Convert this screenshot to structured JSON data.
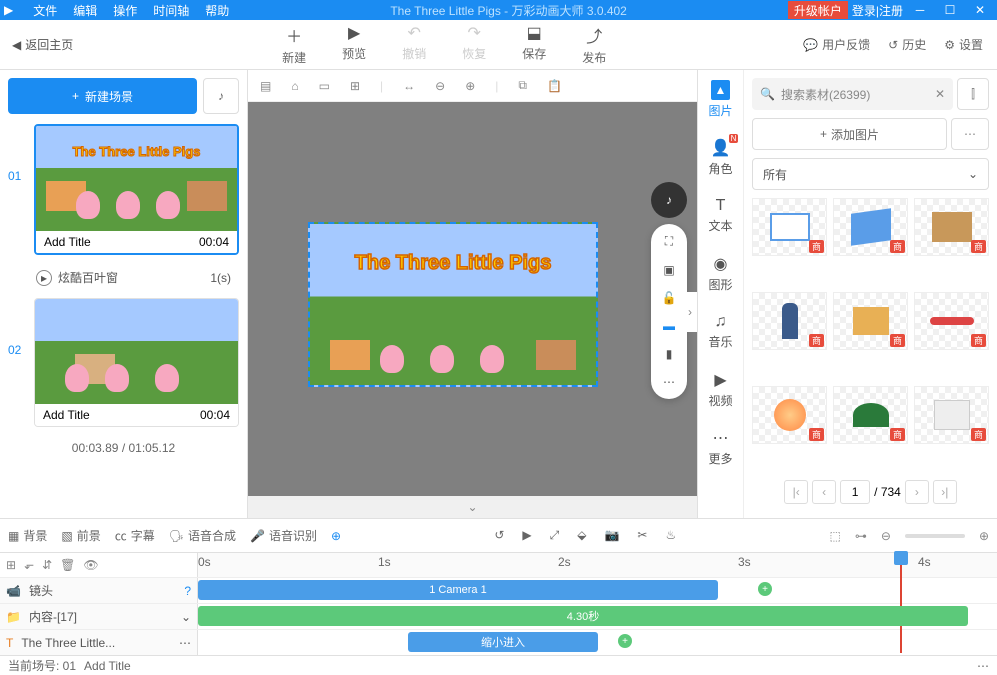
{
  "titlebar": {
    "menus": [
      "文件",
      "编辑",
      "操作",
      "时间轴",
      "帮助"
    ],
    "title": "The Three Little Pigs - 万彩动画大师 3.0.402",
    "upgrade": "升级帐户",
    "login": "登录|注册"
  },
  "toolbar": {
    "back": "返回主页",
    "actions": {
      "new": "新建",
      "preview": "预览",
      "undo": "撤销",
      "redo": "恢复",
      "save": "保存",
      "publish": "发布"
    },
    "right": {
      "feedback": "用户反馈",
      "history": "历史",
      "settings": "设置"
    }
  },
  "scenes": {
    "new_scene": "新建场景",
    "items": [
      {
        "num": "01",
        "title": "Add Title",
        "time": "00:04",
        "thumb_title": "The Three Little Pigs"
      },
      {
        "num": "02",
        "title": "Add Title",
        "time": "00:04"
      }
    ],
    "transition": {
      "name": "炫酷百叶窗",
      "dur": "1(s)"
    },
    "current_time": "00:03.89",
    "total_time": "01:05.12"
  },
  "canvas": {
    "title_text": "The Three Little Pigs"
  },
  "vtabs": {
    "image": "图片",
    "role": "角色",
    "text": "文本",
    "shape": "图形",
    "music": "音乐",
    "video": "视频",
    "more": "更多"
  },
  "assets": {
    "search_placeholder": "搜索素材(26399)",
    "add_image": "添加图片",
    "category": "所有",
    "page_current": "1",
    "page_total": "734"
  },
  "timeline_bar": {
    "bg": "背景",
    "fg": "前景",
    "subtitle": "字幕",
    "tts": "语音合成",
    "asr": "语音识别"
  },
  "timeline": {
    "ticks": [
      "0s",
      "1s",
      "2s",
      "3s",
      "4s"
    ],
    "camera_label": "镜头",
    "content_label": "内容-[17]",
    "text_label": "The Three Little...",
    "clip_camera": "1 Camera 1",
    "clip_duration": "4.30秒",
    "clip_effect": "缩小进入"
  },
  "status": {
    "scene": "当前场号: 01",
    "title": "Add Title"
  }
}
